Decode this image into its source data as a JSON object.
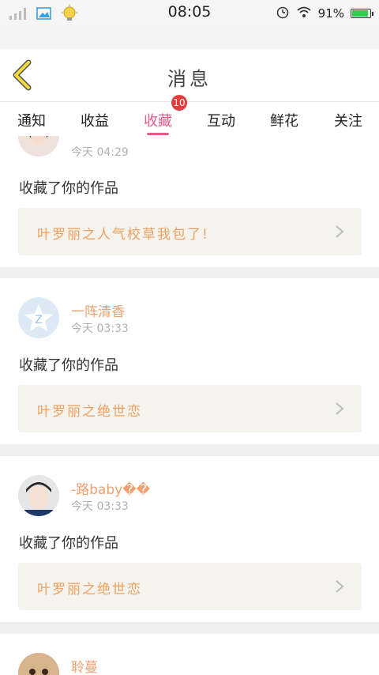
{
  "status": {
    "time": "08:05",
    "battery": "91%",
    "battery_level": 0.91
  },
  "header": {
    "title": "消息"
  },
  "tabs": [
    {
      "label": "通知"
    },
    {
      "label": "收益"
    },
    {
      "label": "收藏",
      "active": true,
      "badge": "10"
    },
    {
      "label": "互动"
    },
    {
      "label": "鲜花"
    },
    {
      "label": "关注"
    }
  ],
  "items": [
    {
      "name": "",
      "time": "今天 04:29",
      "action": "收藏了你的作品",
      "work": "叶罗丽之人气校草我包了!"
    },
    {
      "name": "一阵清香",
      "time": "今天 03:33",
      "action": "收藏了你的作品",
      "work": "叶罗丽之绝世恋"
    },
    {
      "name": "-路baby��",
      "time": "今天 03:33",
      "action": "收藏了你的作品",
      "work": "叶罗丽之绝世恋"
    },
    {
      "name": "聆蔓",
      "time": "",
      "action": "",
      "work": ""
    }
  ]
}
